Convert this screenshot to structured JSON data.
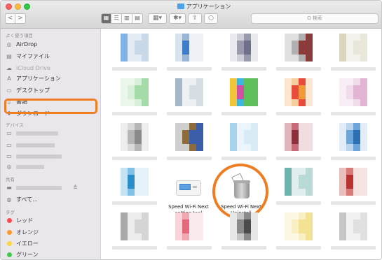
{
  "window": {
    "title": "アプリケーション",
    "nav_back": "<",
    "nav_forward": ">",
    "view_icons": [
      "▦",
      "☰",
      "▥",
      "▤"
    ],
    "arrange_label": "▦▾",
    "action_label": "✱▾",
    "share_label": "⇧",
    "tag_label": "○",
    "search_placeholder": "Q 検索"
  },
  "sidebar": {
    "favorites_header": "よく使う項目",
    "favorites": [
      {
        "label": "AirDrop",
        "icon": "airdrop-icon",
        "glyph": "◎"
      },
      {
        "label": "マイファイル",
        "icon": "all-files-icon",
        "glyph": "▤"
      },
      {
        "label": "iCloud Drive",
        "icon": "cloud-icon",
        "glyph": "☁"
      },
      {
        "label": "アプリケーション",
        "icon": "applications-icon",
        "glyph": "A"
      },
      {
        "label": "デスクトップ",
        "icon": "desktop-icon",
        "glyph": "▭"
      },
      {
        "label": "書類",
        "icon": "documents-icon",
        "glyph": "▯"
      },
      {
        "label": "ダウンロード",
        "icon": "downloads-icon",
        "glyph": "⬇"
      }
    ],
    "devices_header": "デバイス",
    "shared_header": "共有",
    "shared_all_label": "すべて...",
    "eject_glyph": "≜",
    "tags_header": "タグ",
    "tags": [
      {
        "label": "レッド",
        "color": "#fc4b4e"
      },
      {
        "label": "オレンジ",
        "color": "#fd9a2d"
      },
      {
        "label": "イエロー",
        "color": "#fdd73b"
      },
      {
        "label": "グリーン",
        "color": "#45c94c"
      }
    ]
  },
  "apps": {
    "router_tool_line1": "Speed Wi-Fi Next",
    "router_tool_line2": "setting tool",
    "uninstall_line1": "Speed Wi-Fi Next",
    "uninstall_line2": "Uninstall"
  },
  "colors": {
    "highlight": "#ef7d22",
    "sidebar_bg": "#e9e6ec",
    "accent_blue": "#4aa3e8"
  }
}
